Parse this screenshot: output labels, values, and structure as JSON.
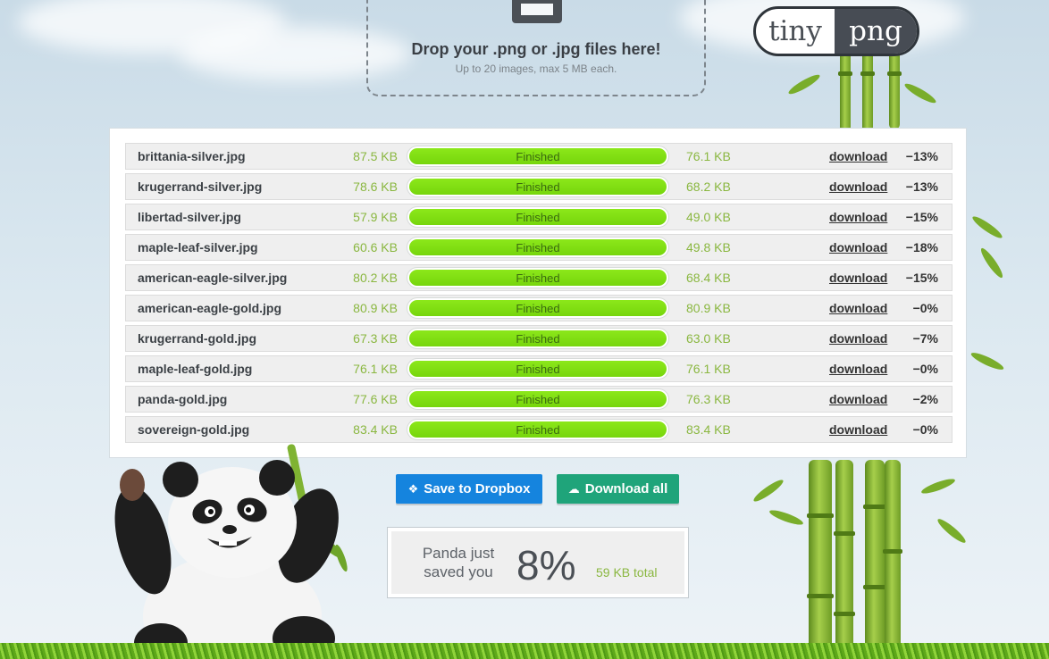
{
  "upload": {
    "title": "Drop your .png or .jpg files here!",
    "subtitle": "Up to 20 images, max 5 MB each."
  },
  "logo": {
    "left": "tiny",
    "right": "png"
  },
  "files": [
    {
      "name": "brittania-silver.jpg",
      "original": "87.5 KB",
      "status": "Finished",
      "progress": 1.0,
      "compressed": "76.1 KB",
      "action": "download",
      "saving": "−13%"
    },
    {
      "name": "krugerrand-silver.jpg",
      "original": "78.6 KB",
      "status": "Finished",
      "progress": 1.0,
      "compressed": "68.2 KB",
      "action": "download",
      "saving": "−13%"
    },
    {
      "name": "libertad-silver.jpg",
      "original": "57.9 KB",
      "status": "Finished",
      "progress": 1.0,
      "compressed": "49.0 KB",
      "action": "download",
      "saving": "−15%"
    },
    {
      "name": "maple-leaf-silver.jpg",
      "original": "60.6 KB",
      "status": "Finished",
      "progress": 1.0,
      "compressed": "49.8 KB",
      "action": "download",
      "saving": "−18%"
    },
    {
      "name": "american-eagle-silver.jpg",
      "original": "80.2 KB",
      "status": "Finished",
      "progress": 1.0,
      "compressed": "68.4 KB",
      "action": "download",
      "saving": "−15%"
    },
    {
      "name": "american-eagle-gold.jpg",
      "original": "80.9 KB",
      "status": "Finished",
      "progress": 1.0,
      "compressed": "80.9 KB",
      "action": "download",
      "saving": "−0%"
    },
    {
      "name": "krugerrand-gold.jpg",
      "original": "67.3 KB",
      "status": "Finished",
      "progress": 1.0,
      "compressed": "63.0 KB",
      "action": "download",
      "saving": "−7%"
    },
    {
      "name": "maple-leaf-gold.jpg",
      "original": "76.1 KB",
      "status": "Finished",
      "progress": 1.0,
      "compressed": "76.1 KB",
      "action": "download",
      "saving": "−0%"
    },
    {
      "name": "panda-gold.jpg",
      "original": "77.6 KB",
      "status": "Finished",
      "progress": 1.0,
      "compressed": "76.3 KB",
      "action": "download",
      "saving": "−2%"
    },
    {
      "name": "sovereign-gold.jpg",
      "original": "83.4 KB",
      "status": "Finished",
      "progress": 1.0,
      "compressed": "83.4 KB",
      "action": "download",
      "saving": "−0%"
    }
  ],
  "buttons": {
    "dropbox": "Save to Dropbox",
    "download_all": "Download all"
  },
  "savings": {
    "label_line1": "Panda just",
    "label_line2": "saved you",
    "percent": "8%",
    "total": "59 KB total"
  },
  "colors": {
    "progress_fill": "#7ddc10",
    "size_text": "#8ab740",
    "dropbox_button": "#1584de",
    "download_button": "#1fa47a"
  },
  "icons": {
    "upload": "download-tray-icon",
    "dropbox": "dropbox-icon",
    "download_all": "cloud-download-icon"
  }
}
